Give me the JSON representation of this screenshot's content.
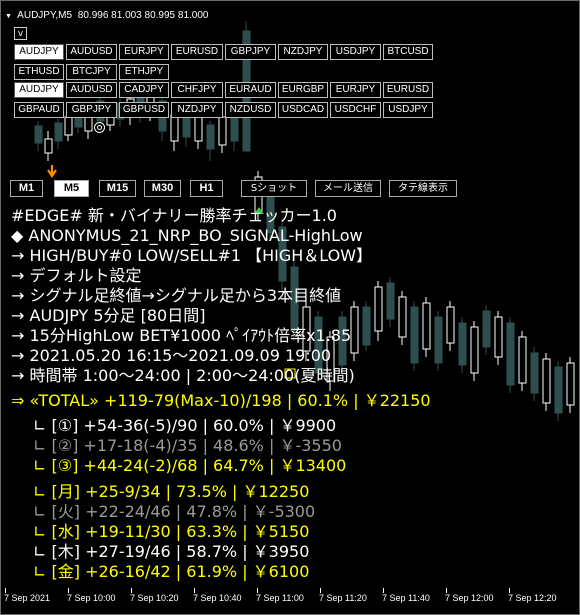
{
  "title": {
    "symbol_tf": "AUDJPY,M5",
    "ohlc": "80.996 81.003 80.995 81.000"
  },
  "v_button": "v",
  "symbols_row1": [
    "AUDJPY",
    "AUDUSD",
    "EURJPY",
    "EURUSD",
    "GBPJPY",
    "NZDJPY",
    "USDJPY",
    "BTCUSD"
  ],
  "symbols_row2": [
    "ETHUSD",
    "BTCJPY",
    "ETHJPY"
  ],
  "symbols_row3": [
    "AUDJPY",
    "AUDUSD",
    "CADJPY",
    "CHFJPY",
    "EURAUD",
    "EURGBP",
    "EURJPY",
    "EURUSD"
  ],
  "symbols_row4": [
    "GBPAUD",
    "GBPJPY",
    "GBPUSD",
    "NZDJPY",
    "NZDUSD",
    "USDCAD",
    "USDCHF",
    "USDJPY"
  ],
  "timeframes": [
    "M1",
    "M5",
    "M15",
    "M30",
    "H1"
  ],
  "actions": [
    "Sショット",
    "メール送信",
    "タテ線表示"
  ],
  "info": {
    "l1": "#EDGE# 新・バイナリー勝率チェッカー1.0",
    "l2": "◆ ANONYMUS_21_NRP_BO_SIGNAL-HighLow",
    "l3": "→ HIGH/BUY#0  LOW/SELL#1   【HIGH＆LOW】",
    "l4": "→ デフォルト設定",
    "l5": "→ シグナル足終値→シグナル足から3本目終値",
    "l6": "→ AUDJPY    5分足   [80日間]",
    "l7": "→ 15分HighLow  BET¥1000  ﾍﾟｲｱｳﾄ倍率x1.85",
    "l8": "→ 2021.05.20 16:15～2021.09.09 19:00",
    "l9": "→ 時間帯 1:00～24:00 | 2:00～24:00(夏時間)",
    "total": "⇒ «TOTAL» +119-79(Max-10)/198 | 60.1% | ￥22150",
    "s1": "∟ [①] +54-36(-5)/90 | 60.0% | ￥9900",
    "s2": "∟ [②] +17-18(-4)/35 | 48.6% | ￥-3550",
    "s3": "∟ [③] +44-24(-2)/68 | 64.7% | ￥13400",
    "d1": "∟ [月] +25-9/34 | 73.5% | ￥12250",
    "d2": "∟ [火] +22-24/46 | 47.8% | ￥-5300",
    "d3": "∟ [水] +19-11/30 | 63.3% | ￥5150",
    "d4": "∟ [木] +27-19/46 | 58.7% | ￥3950",
    "d5": "∟ [金] +26-16/42 | 61.9% | ￥6100"
  },
  "xaxis": [
    "7 Sep 2021",
    "7 Sep 10:00",
    "7 Sep 10:20",
    "7 Sep 10:40",
    "7 Sep 11:00",
    "7 Sep 11:20",
    "7 Sep 11:40",
    "7 Sep 12:00",
    "7 Sep 12:20"
  ],
  "colors": {
    "bull_candle": "#ffffff",
    "bear_candle": "#2f4f4f",
    "highlight": "#ffff00",
    "muted": "#9a9a9a",
    "arrow_orange": "#ff8c00",
    "arrow_green": "#2ecc40"
  }
}
